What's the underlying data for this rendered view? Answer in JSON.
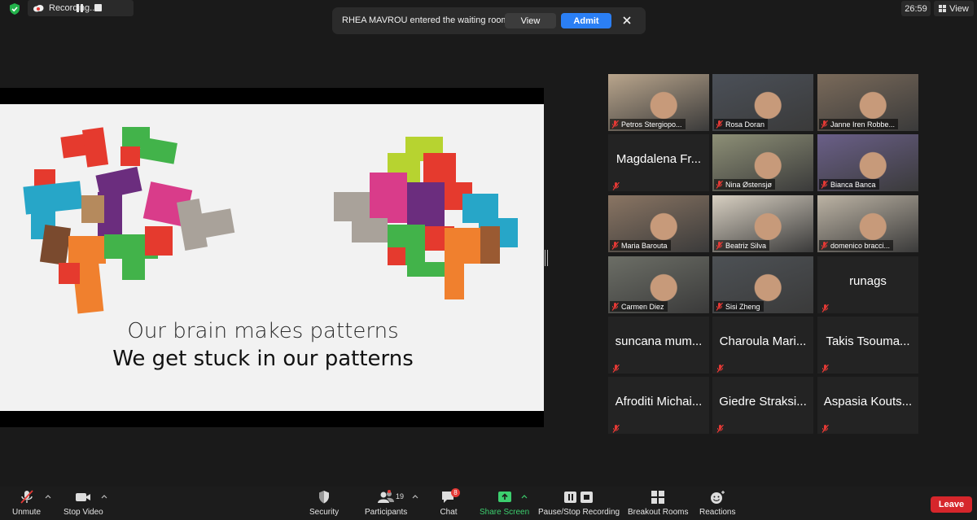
{
  "recording": {
    "label": "Recording..."
  },
  "notification": {
    "message": "RHEA MAVROU entered the waiting room",
    "view_label": "View",
    "admit_label": "Admit"
  },
  "timer": "26:59",
  "view_menu": "View",
  "slide": {
    "line1": "Our brain makes patterns",
    "line2": "We get stuck in our patterns"
  },
  "participants": [
    {
      "name": "Petros Stergiopo...",
      "video": true
    },
    {
      "name": "Rosa Doran",
      "video": true
    },
    {
      "name": "Janne Iren Robbe...",
      "video": true
    },
    {
      "name": "Magdalena Fr...",
      "video": false
    },
    {
      "name": "Nina Østensjø",
      "video": true,
      "active": true
    },
    {
      "name": "Bianca Banca",
      "video": true
    },
    {
      "name": "Maria Barouta",
      "video": true
    },
    {
      "name": "Beatriz Silva",
      "video": true
    },
    {
      "name": "domenico bracci...",
      "video": true
    },
    {
      "name": "Carmen Diez",
      "video": true
    },
    {
      "name": "Sisi Zheng",
      "video": true
    },
    {
      "name": "runags",
      "video": false
    },
    {
      "name": "suncana mum...",
      "video": false
    },
    {
      "name": "Charoula Mari...",
      "video": false
    },
    {
      "name": "Takis Tsouma...",
      "video": false
    },
    {
      "name": "Afroditi Michai...",
      "video": false
    },
    {
      "name": "Giedre Straksi...",
      "video": false
    },
    {
      "name": "Aspasia Kouts...",
      "video": false
    }
  ],
  "toolbar": {
    "unmute": "Unmute",
    "stop_video": "Stop Video",
    "security": "Security",
    "participants": "Participants",
    "participant_count": "19",
    "chat": "Chat",
    "chat_badge": "8",
    "share_screen": "Share Screen",
    "recording": "Pause/Stop Recording",
    "breakout": "Breakout Rooms",
    "reactions": "Reactions",
    "leave": "Leave"
  },
  "colors": {
    "accent": "#2b7ff4",
    "leave": "#d6262b",
    "share_green": "#3ccf6e",
    "active_speaker": "#c9e35d"
  }
}
